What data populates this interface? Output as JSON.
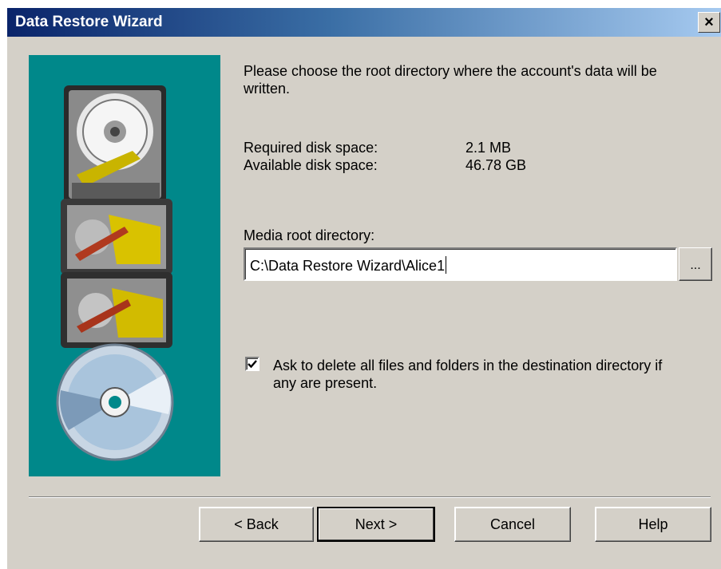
{
  "window": {
    "title": "Data Restore Wizard",
    "close_glyph": "×"
  },
  "content": {
    "instruction": "Please choose the root directory where the account's data will be written.",
    "required_label": "Required disk space:",
    "required_value": "2.1 MB",
    "available_label": "Available disk space:",
    "available_value": "46.78 GB",
    "media_label": "Media root directory:",
    "media_path": "C:\\Data Restore Wizard\\Alice1",
    "browse_label": "...",
    "checkbox_checked": true,
    "checkbox_label": "Ask to delete all files and folders in the destination directory if any are present."
  },
  "buttons": {
    "back": "< Back",
    "next": "Next >",
    "cancel": "Cancel",
    "help": "Help"
  },
  "icons": {
    "side_illustration": "hard-drives-and-cd-illustration",
    "close": "close-icon",
    "check": "checkmark-icon"
  },
  "colors": {
    "panel": "#00888a",
    "dialog": "#d4d0c8",
    "title_start": "#0a246a",
    "title_end": "#a6caf0"
  }
}
